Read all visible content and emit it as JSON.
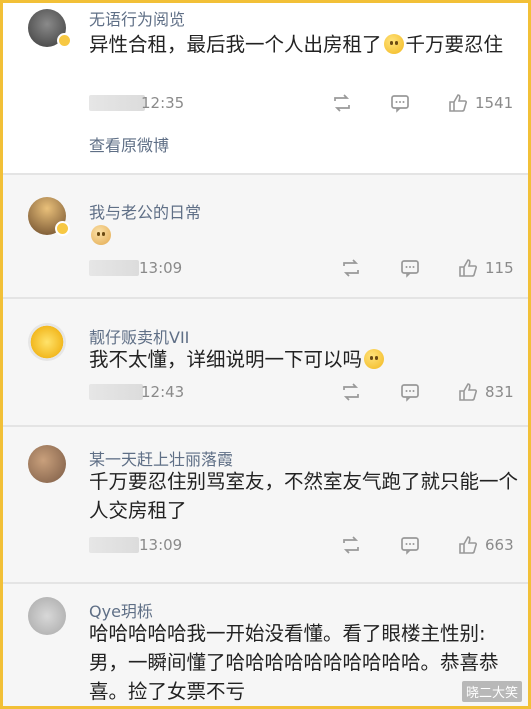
{
  "comments": [
    {
      "username": "无语行为阅览",
      "content_parts": [
        "异性合租，最后我一个人出房租了",
        "",
        "千万要忍住"
      ],
      "time": "12:35",
      "likes": "1541",
      "view_original": "查看原微博"
    },
    {
      "username": "我与老公的日常",
      "content_parts": [
        "",
        "",
        ""
      ],
      "time": "13:09",
      "likes": "115"
    },
    {
      "username": "靓仔贩卖机VII",
      "content_parts": [
        "我不太懂，详细说明一下可以吗",
        "",
        ""
      ],
      "time": "12:43",
      "likes": "831"
    },
    {
      "username": "某一天赶上壮丽落霞",
      "content_parts": [
        "千万要忍住别骂室友，不然室友气跑了就只能一个人交房租了",
        "",
        ""
      ],
      "time": "13:09",
      "likes": "663"
    },
    {
      "username": "Qye玥栎",
      "content_parts": [
        "哈哈哈哈哈我一开始没看懂。看了眼楼主性别:男，一瞬间懂了哈哈哈哈哈哈哈哈哈哈。恭喜恭喜。捡了女票不亏",
        "",
        ""
      ]
    }
  ],
  "watermark": "晓二大笑",
  "colors": {
    "border": "#f2c037",
    "username": "#5f6f86",
    "meta": "#8a8a8a"
  },
  "icons": [
    "repost-icon",
    "comment-icon",
    "like-icon",
    "emoji-icon"
  ]
}
